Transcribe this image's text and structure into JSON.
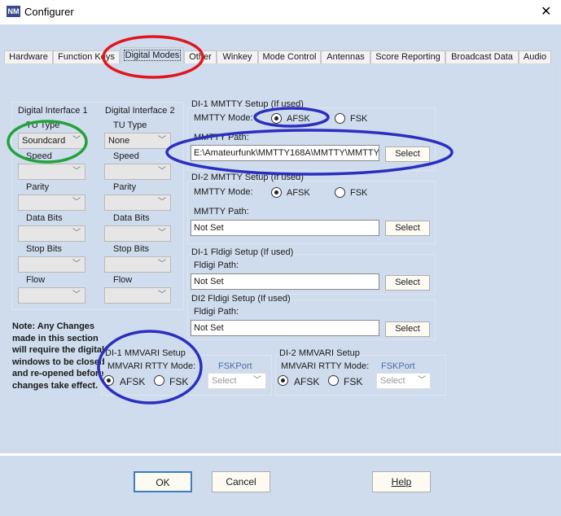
{
  "window": {
    "title": "Configurer",
    "close": "✕",
    "logo": "NM"
  },
  "tabs": [
    "Hardware",
    "Function Keys",
    "Digital Modes",
    "Other",
    "Winkey",
    "Mode Control",
    "Antennas",
    "Score Reporting",
    "Broadcast Data",
    "Audio"
  ],
  "active_tab": "Digital Modes",
  "di1": {
    "header": "Digital Interface 1",
    "tu_type_label": "TU Type",
    "tu_type": "Soundcard",
    "speed_label": "Speed",
    "parity_label": "Parity",
    "data_bits_label": "Data Bits",
    "stop_bits_label": "Stop Bits",
    "flow_label": "Flow"
  },
  "di2": {
    "header": "Digital Interface 2",
    "tu_type_label": "TU Type",
    "tu_type": "None",
    "speed_label": "Speed",
    "parity_label": "Parity",
    "data_bits_label": "Data Bits",
    "stop_bits_label": "Stop Bits",
    "flow_label": "Flow"
  },
  "mmtty1": {
    "header": "DI-1 MMTTY Setup (If used)",
    "mode_label": "MMTTY Mode:",
    "afsk": "AFSK",
    "fsk": "FSK",
    "selected": "AFSK",
    "path_label": "MMTTY Path:",
    "path": "E:\\Amateurfunk\\MMTTY168A\\MMTTY\\MMTTY.",
    "select": "Select"
  },
  "mmtty2": {
    "header": "DI-2 MMTTY Setup (If used)",
    "mode_label": "MMTTY Mode:",
    "afsk": "AFSK",
    "fsk": "FSK",
    "selected": "AFSK",
    "path_label": "MMTTY Path:",
    "path": "Not Set",
    "select": "Select"
  },
  "fldigi1": {
    "header": "DI-1 Fldigi Setup (If used)",
    "path_label": "Fldigi Path:",
    "path": "Not Set",
    "select": "Select"
  },
  "fldigi2": {
    "header": "DI2 Fldigi Setup (If used)",
    "path_label": "Fldigi Path:",
    "path": "Not Set",
    "select": "Select"
  },
  "note": "Note: Any Changes made in this section will require the digital windows to be closed and re-opened before changes take effect.",
  "mmvari1": {
    "header": "DI-1 MMVARI Setup",
    "mode_label": "MMVARI RTTY Mode:",
    "afsk": "AFSK",
    "fsk": "FSK",
    "selected": "AFSK",
    "fskport_label": "FSKPort",
    "fskport": "Select"
  },
  "mmvari2": {
    "header": "DI-2 MMVARI Setup",
    "mode_label": "MMVARI RTTY Mode:",
    "afsk": "AFSK",
    "fsk": "FSK",
    "selected": "AFSK",
    "fskport_label": "FSKPort",
    "fskport": "Select"
  },
  "buttons": {
    "ok": "OK",
    "cancel": "Cancel",
    "help": "Help"
  },
  "annotation_colors": {
    "red": "#e0161e",
    "green": "#22a33a",
    "blue": "#2b2fbf"
  }
}
